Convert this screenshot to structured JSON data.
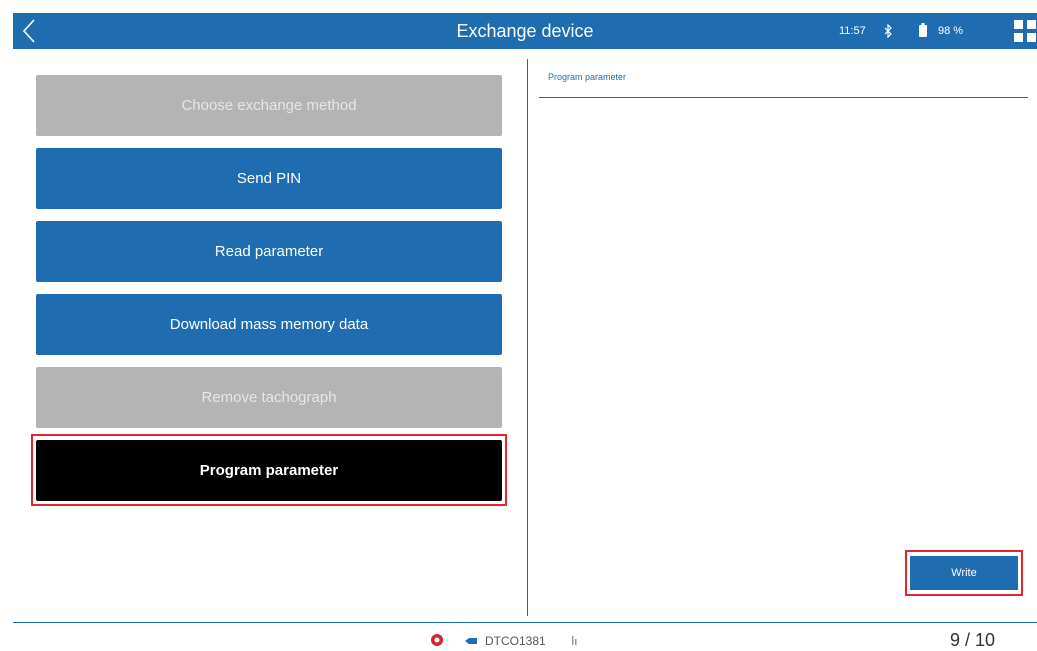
{
  "header": {
    "title": "Exchange device",
    "time": "11:57",
    "battery": "98 %"
  },
  "menu": {
    "items": [
      {
        "label": "Choose exchange method"
      },
      {
        "label": "Send PIN"
      },
      {
        "label": "Read parameter"
      },
      {
        "label": "Download mass memory data"
      },
      {
        "label": "Remove tachograph"
      },
      {
        "label": "Program parameter"
      }
    ]
  },
  "panel": {
    "title": "Program parameter",
    "write_label": "Write"
  },
  "footer": {
    "device": "DTCO1381",
    "page": "9 / 10"
  },
  "colors": {
    "primary": "#1f6db0",
    "disabled": "#b4b4b4",
    "active": "#000000",
    "highlight": "#e1262e"
  },
  "icons": {
    "back": "chevron-left-icon",
    "bluetooth": "bluetooth-icon",
    "battery": "battery-icon",
    "apps": "grid-icon",
    "tachograph": "tachograph-icon",
    "cable": "cable-icon",
    "signal": "signal-icon"
  }
}
